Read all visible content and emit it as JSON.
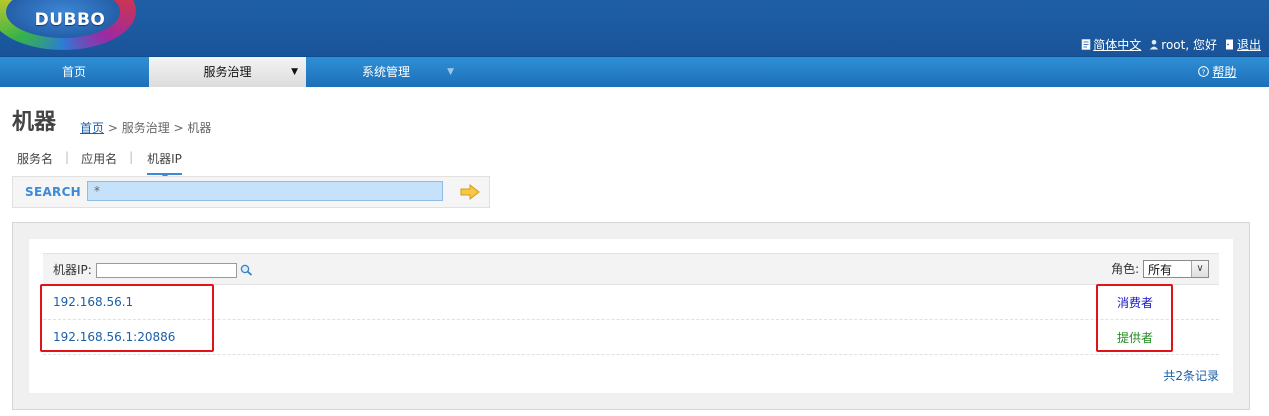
{
  "app": {
    "logo_text": "DUBBO"
  },
  "header": {
    "language_label": "简体中文",
    "user_label": "root, 您好",
    "logout_label": "退出"
  },
  "nav": {
    "home": "首页",
    "service_governance": "服务治理",
    "system_management": "系统管理",
    "help": "帮助"
  },
  "page": {
    "title": "机器",
    "breadcrumb": {
      "home": "首页",
      "rest": " > 服务治理 > 机器"
    }
  },
  "tabs": {
    "service_name": "服务名",
    "app_name": "应用名",
    "machine_ip": "机器IP",
    "separator": "|"
  },
  "search": {
    "label": "SEARCH",
    "value": "*"
  },
  "filter": {
    "ip_label": "机器IP:",
    "ip_value": "",
    "role_label": "角色:",
    "role_selected": "所有"
  },
  "rows": [
    {
      "ip": "192.168.56.1",
      "role": "消费者",
      "role_color": "#1414c8"
    },
    {
      "ip": "192.168.56.1:20886",
      "role": "提供者",
      "role_color": "#1f8a1f"
    }
  ],
  "footer": {
    "record_count": "共2条记录"
  },
  "colors": {
    "header_bg": "#1f5fa6",
    "nav_bg": "#2e8fd6",
    "link": "#1a5fa8",
    "highlight": "#e0131a"
  }
}
